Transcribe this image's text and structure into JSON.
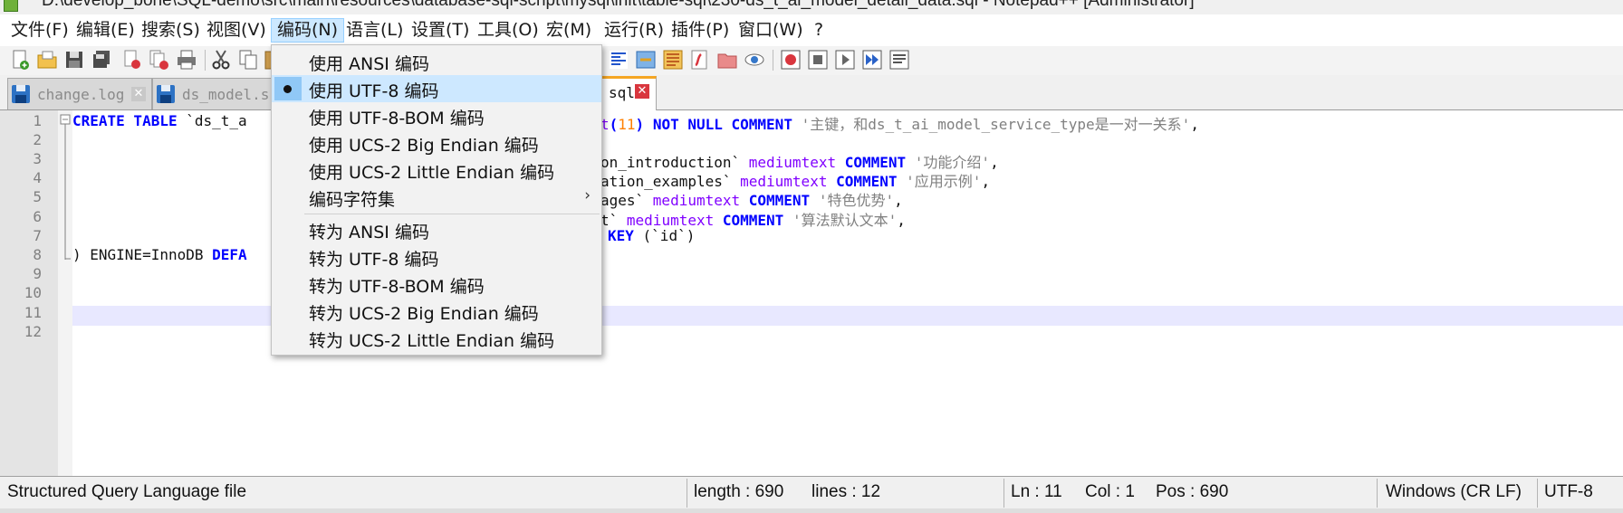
{
  "window": {
    "title": "D:\\develop_bone\\SQL-demo\\src\\main\\resources\\database-sql-script\\mysql\\init\\table-sql\\230-ds_t_ai_model_detail_data.sql - Notepad++ [Administrator]"
  },
  "menubar": {
    "items": [
      "文件(F)",
      "编辑(E)",
      "搜索(S)",
      "视图(V)",
      "编码(N)",
      "语言(L)",
      "设置(T)",
      "工具(O)",
      "宏(M)",
      "运行(R)",
      "插件(P)",
      "窗口(W)",
      "?"
    ],
    "active_index": 4
  },
  "toolbar": {
    "icons": [
      "new-file-icon",
      "open-file-icon",
      "save-icon",
      "save-all-icon",
      "close-icon",
      "close-all-icon",
      "print-icon",
      "cut-icon",
      "copy-icon",
      "paste-icon",
      "wrap-icon",
      "indent-guide-icon",
      "doc-map-icon",
      "function-list-icon",
      "folder-icon",
      "monitor-icon",
      "record-macro-icon",
      "stop-macro-icon",
      "play-macro-icon",
      "run-macro-multiple-icon",
      "save-macro-icon"
    ]
  },
  "tabs": [
    {
      "label": "change.log",
      "active": false
    },
    {
      "label": "ds_model.s",
      "active": false
    },
    {
      "label": "sql",
      "active": true
    }
  ],
  "encoding_menu": {
    "items": [
      {
        "label": "使用 ANSI 编码"
      },
      {
        "label": "使用 UTF-8 编码",
        "checked": true
      },
      {
        "label": "使用 UTF-8-BOM 编码"
      },
      {
        "label": "使用 UCS-2 Big Endian 编码"
      },
      {
        "label": "使用 UCS-2 Little Endian 编码"
      },
      {
        "label": "编码字符集",
        "submenu": true
      },
      {
        "label": "转为 ANSI 编码"
      },
      {
        "label": "转为 UTF-8 编码"
      },
      {
        "label": "转为 UTF-8-BOM 编码"
      },
      {
        "label": "转为 UCS-2 Big Endian 编码"
      },
      {
        "label": "转为 UCS-2 Little Endian 编码"
      }
    ]
  },
  "editor": {
    "line_numbers": [
      "1",
      "2",
      "3",
      "4",
      "5",
      "6",
      "7",
      "8",
      "9",
      "10",
      "11",
      "12"
    ],
    "current_line": 11,
    "code_left": {
      "l1_kw": "CREATE TABLE",
      "l1_rest": " `ds_t_a",
      "l8_rest": ") ENGINE=InnoDB ",
      "l8_kw": "DEFA"
    },
    "code_right": {
      "l1_a": "t",
      "l1_paren_open": "(",
      "l1_num": "11",
      "l1_paren_close": ")",
      "l1_kw": " NOT NULL COMMENT ",
      "l1_str": "'主键，和ds_t_ai_model_service_type是一对一关系'",
      "l1_end": ",",
      "l3_a": "on_introduction` ",
      "l3_ty": "mediumtext",
      "l3_kw": " COMMENT ",
      "l3_str": "'功能介绍'",
      "l3_end": ",",
      "l4_a": "ation_examples` ",
      "l4_ty": "mediumtext",
      "l4_kw": " COMMENT ",
      "l4_str": "'应用示例'",
      "l4_end": ",",
      "l5_a": "ages` ",
      "l5_ty": "mediumtext",
      "l5_kw": " COMMENT ",
      "l5_str": "'特色优势'",
      "l5_end": ",",
      "l6_a": "t` ",
      "l6_ty": "mediumtext",
      "l6_kw": " COMMENT ",
      "l6_str": "'算法默认文本'",
      "l6_end": ",",
      "l7_kw": "KEY",
      "l7_rest": " (`id`)"
    }
  },
  "statusbar": {
    "file_type": "Structured Query Language file",
    "length": "length : 690",
    "lines": "lines : 12",
    "ln": "Ln : 11",
    "col": "Col : 1",
    "pos": "Pos : 690",
    "eol": "Windows (CR LF)",
    "encoding": "UTF-8"
  }
}
